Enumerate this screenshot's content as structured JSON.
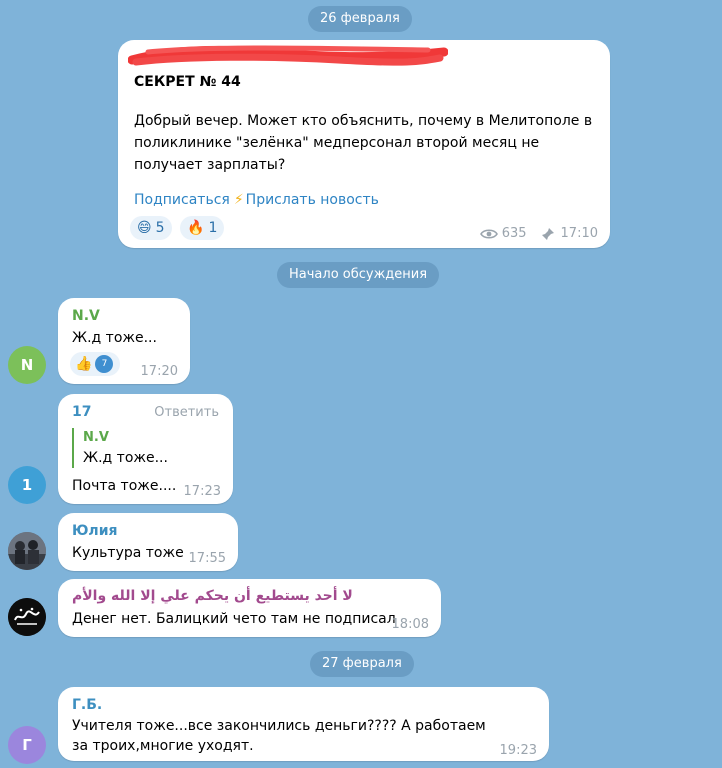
{
  "dates": {
    "first": "26 февраля",
    "discussion": "Начало обсуждения",
    "second": "27 февраля"
  },
  "channel_post": {
    "channel_name_redacted": "",
    "title": "СЕКРЕТ № 44",
    "text": "Добрый вечер. Может кто объяснить, почему в Мелитополе в поликлинике \"зелёнка\" медперсонал второй месяц не получает зарплаты?",
    "subscribe_link": "Подписаться",
    "bolt_icon": "⚡",
    "send_news_link": "Прислать новость",
    "reactions": [
      {
        "emoji": "😄",
        "count": "5"
      },
      {
        "emoji": "🔥",
        "count": "1"
      }
    ],
    "views": "635",
    "time": "17:10"
  },
  "messages": [
    {
      "author": "N.V",
      "author_color": "#5ba84a",
      "avatar_letter": "N",
      "avatar_color": "#7cc05a",
      "text": "Ж.д тоже...",
      "reaction_emoji": "👍",
      "reaction_badge": "7",
      "time": "17:20"
    },
    {
      "author": "17",
      "author_color": "#3d8fc0",
      "avatar_letter": "1",
      "avatar_color": "#3fa0d6",
      "reply_action": "Ответить",
      "quote_author": "N.V",
      "quote_text": "Ж.д тоже...",
      "text": "Почта тоже....",
      "time": "17:23"
    },
    {
      "author": "Юлия",
      "author_color": "#3d8fc0",
      "text": "Культура тоже",
      "time": "17:55"
    },
    {
      "author": "لا أحد يستطيع أن يحكم علي إلا الله والأم",
      "author_color": "#a24a8e",
      "text": "Денег нет. Балицкий чето там не подписал",
      "time": "18:08"
    },
    {
      "author": "Г.Б.",
      "author_color": "#3d8fc0",
      "avatar_letter": "Г",
      "avatar_color": "#9b86dd",
      "text": "Учителя тоже...все закончились деньги???? А работаем за троих,многие уходят.",
      "time": "19:23"
    }
  ]
}
